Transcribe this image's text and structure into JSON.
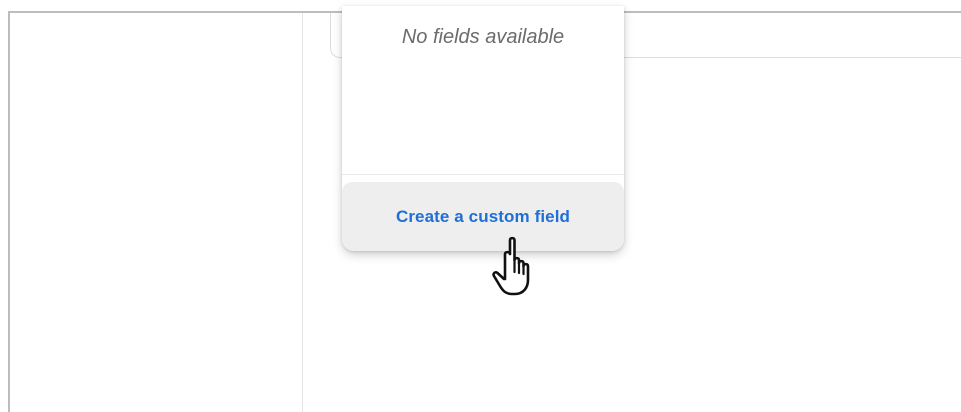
{
  "dropdown": {
    "empty_message": "No fields available",
    "create_button_label": "Create a custom field"
  },
  "colors": {
    "link_blue": "#1f6fd6",
    "muted_text": "#6b6b6b",
    "button_bg": "#eeeeee"
  },
  "cursor": {
    "icon": "hand-pointer-icon"
  }
}
